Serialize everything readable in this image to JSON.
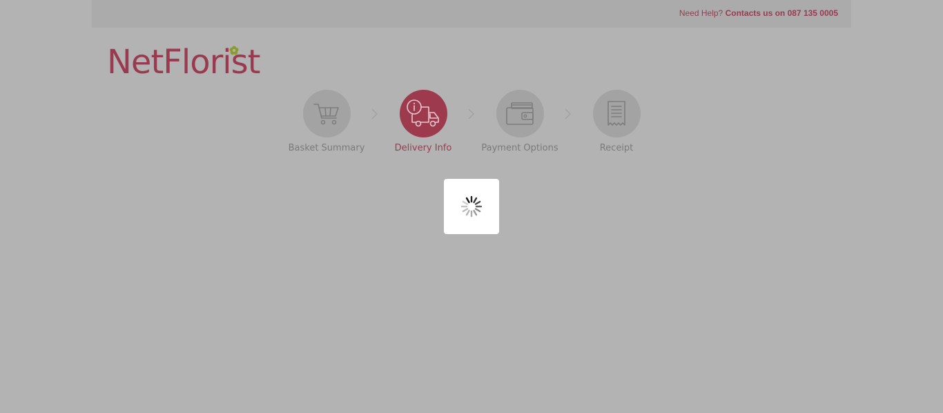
{
  "header": {
    "help_prefix": "Need Help?",
    "help_contact": "Contacts us on 087 135 0005"
  },
  "logo": {
    "text": "NetFlorist",
    "brand_color": "#9a3a50",
    "flower_color": "#8f9a2e"
  },
  "steps": [
    {
      "label": "Basket Summary",
      "icon": "cart-icon",
      "active": false
    },
    {
      "label": "Delivery Info",
      "icon": "delivery-truck-icon",
      "active": true
    },
    {
      "label": "Payment Options",
      "icon": "wallet-icon",
      "active": false
    },
    {
      "label": "Receipt",
      "icon": "receipt-icon",
      "active": false
    }
  ],
  "overlay": {
    "state": "loading",
    "icon": "loading-spinner-icon"
  },
  "colors": {
    "accent": "#9e3a4e",
    "overlay_bg": "#b3b3b3"
  }
}
